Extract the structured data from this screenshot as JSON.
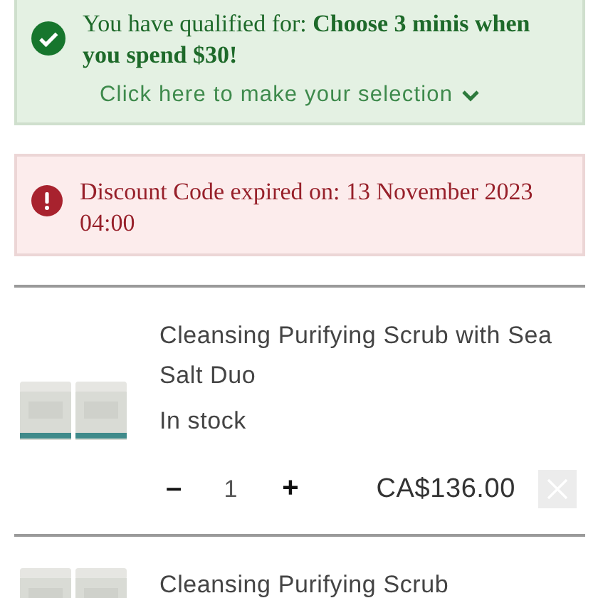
{
  "alerts": [
    {
      "kind": "success",
      "message": "You have qualified for: **Choose 3 minis when you spend $30!**",
      "link": "Click here to make your selection"
    },
    {
      "kind": "error",
      "message": "Discount Code expired on: 13 November 2023 04:00"
    }
  ],
  "cart_items": [
    {
      "name": "Cleansing Purifying Scrub with Sea Salt Duo",
      "stock": "In stock",
      "decrease": "–",
      "quantity": "1",
      "increase": "+",
      "price": "CA$136.00"
    },
    {
      "name": "Cleansing Purifying Scrub"
    }
  ]
}
